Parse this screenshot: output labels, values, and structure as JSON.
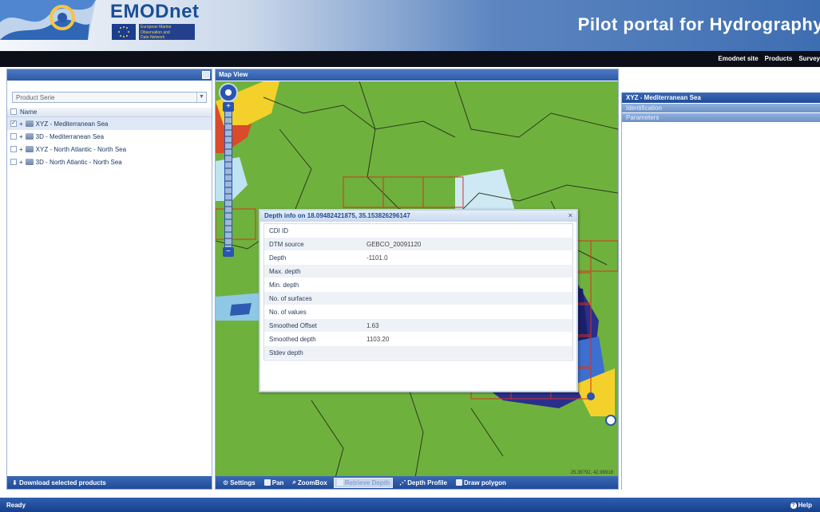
{
  "header": {
    "brand": "EMODnet",
    "eu_lines": [
      "European Marine",
      "Observation and",
      "Data Network"
    ],
    "portal_title": "Pilot portal for Hydrography"
  },
  "topnav": {
    "items": [
      "Emodnet site",
      "Products",
      "Survey"
    ]
  },
  "left_panel": {
    "combo_value": "Product Serie",
    "tree_header": "Name",
    "layers": [
      {
        "label": "XYZ - Mediterranean Sea",
        "checked": true,
        "selected": true
      },
      {
        "label": "3D - Mediterranean Sea",
        "checked": false,
        "selected": false
      },
      {
        "label": "XYZ - North Atlantic - North Sea",
        "checked": false,
        "selected": false
      },
      {
        "label": "3D - North Atlantic - North Sea",
        "checked": false,
        "selected": false
      }
    ],
    "footer_button": "Download selected products"
  },
  "map": {
    "title": "Map View",
    "coords": "25.39792, 42.99918",
    "popup": {
      "title": "Depth info on 18.09482421875, 35.153826296147",
      "rows": [
        {
          "key": "CDI ID",
          "value": ""
        },
        {
          "key": "DTM source",
          "value": "GEBCO_20091120"
        },
        {
          "key": "Depth",
          "value": "-1101.0"
        },
        {
          "key": "Max. depth",
          "value": ""
        },
        {
          "key": "Min. depth",
          "value": ""
        },
        {
          "key": "No. of surfaces",
          "value": ""
        },
        {
          "key": "No. of values",
          "value": ""
        },
        {
          "key": "Smoothed Offset",
          "value": "1.63"
        },
        {
          "key": "Smoothed depth",
          "value": "1103.20"
        },
        {
          "key": "Stdev depth",
          "value": ""
        }
      ]
    },
    "toolbar": {
      "settings": "Settings",
      "pan": "Pan",
      "zoombox": "ZoomBox",
      "retrieve": "Retrieve Depth",
      "depth_profile": "Depth Profile",
      "draw_polygon": "Draw polygon"
    }
  },
  "right_panel": {
    "title": "XYZ - Mediterranean Sea",
    "sections": [
      "Identification",
      "Parameters"
    ]
  },
  "status": {
    "left": "Ready",
    "help": "Help"
  },
  "colors": {
    "accent": "#2b5aa8",
    "header_text": "#1a4f96",
    "land": "#6fb13d"
  }
}
